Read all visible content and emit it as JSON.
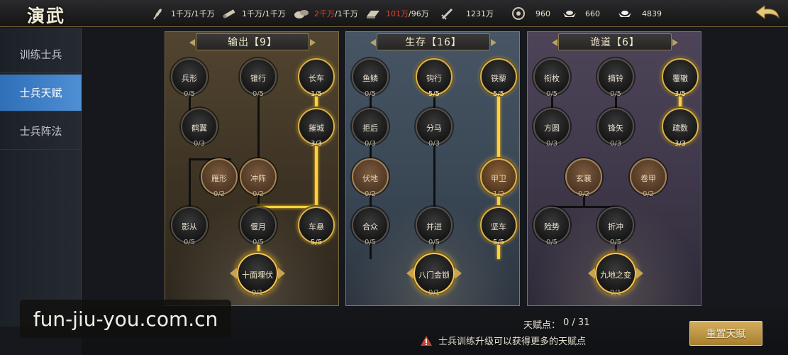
{
  "header": {
    "title": "演武",
    "resources": [
      {
        "icon": "wheat-icon",
        "value": "1千万",
        "cap": "/1千万",
        "over": false
      },
      {
        "icon": "wood-icon",
        "value": "1千万",
        "cap": "/1千万",
        "over": false
      },
      {
        "icon": "stone-icon",
        "value": "2千万",
        "cap": "/1千万",
        "over": true
      },
      {
        "icon": "iron-icon",
        "value": "101万",
        "cap": "/96万",
        "over": true
      },
      {
        "icon": "sword-icon",
        "value": "1231万",
        "cap": "",
        "over": false
      },
      {
        "icon": "coin-icon",
        "value": "960",
        "cap": "",
        "over": false
      },
      {
        "icon": "gold-ingot-icon",
        "value": "660",
        "cap": "",
        "over": false
      },
      {
        "icon": "silver-ingot-icon",
        "value": "4839",
        "cap": "",
        "over": false
      }
    ]
  },
  "sidebar": {
    "items": [
      {
        "label": "训练士兵",
        "active": false
      },
      {
        "label": "士兵天赋",
        "active": true
      },
      {
        "label": "士兵阵法",
        "active": false
      }
    ]
  },
  "panels": [
    {
      "title": "输出【9】",
      "nodes": {
        "bingxing": {
          "name": "兵形",
          "level": "0/5"
        },
        "zhuixing": {
          "name": "锥行",
          "level": "0/5"
        },
        "changche": {
          "name": "长车",
          "level": "1/5"
        },
        "heyi": {
          "name": "鹤翼",
          "level": "0/3"
        },
        "cuicheng": {
          "name": "摧城",
          "level": "3/3"
        },
        "yanxing": {
          "name": "雁形",
          "level": "0/2"
        },
        "chongzhen": {
          "name": "冲阵",
          "level": "0/2"
        },
        "yingcong": {
          "name": "影从",
          "level": "0/5"
        },
        "yanyue": {
          "name": "偃月",
          "level": "0/5"
        },
        "chexuan": {
          "name": "车悬",
          "level": "5/5"
        },
        "ultimate": {
          "name": "十面埋伏",
          "level": "0/1"
        }
      }
    },
    {
      "title": "生存【16】",
      "nodes": {
        "yulin": {
          "name": "鱼鳞",
          "level": "0/5"
        },
        "gouxing": {
          "name": "钩行",
          "level": "5/5"
        },
        "tieli": {
          "name": "铁藜",
          "level": "5/5"
        },
        "juhou": {
          "name": "拒后",
          "level": "0/3"
        },
        "fenma": {
          "name": "分马",
          "level": "0/3"
        },
        "fudi": {
          "name": "伏地",
          "level": "0/2"
        },
        "jiawei": {
          "name": "甲卫",
          "level": "1/2"
        },
        "hezhong": {
          "name": "合众",
          "level": "0/5"
        },
        "bingjin": {
          "name": "并进",
          "level": "0/5"
        },
        "jianche": {
          "name": "坚车",
          "level": "5/5"
        },
        "ultimate": {
          "name": "八门金锁",
          "level": "0/1"
        }
      }
    },
    {
      "title": "诡道【6】",
      "nodes": {
        "xianmei": {
          "name": "衔枚",
          "level": "0/5"
        },
        "zhailing": {
          "name": "摘铃",
          "level": "0/5"
        },
        "fuche": {
          "name": "覆辙",
          "level": "3/5"
        },
        "fangyuan": {
          "name": "方圆",
          "level": "0/3"
        },
        "fengshi": {
          "name": "锋矢",
          "level": "0/3"
        },
        "shushu": {
          "name": "疏数",
          "level": "3/3"
        },
        "xuanxiang": {
          "name": "玄襄",
          "level": "0/2"
        },
        "juanjia": {
          "name": "卷甲",
          "level": "0/2"
        },
        "xianshi": {
          "name": "险势",
          "level": "0/5"
        },
        "zhechong": {
          "name": "折冲",
          "level": "0/5"
        },
        "ultimate": {
          "name": "九地之变",
          "level": "0/1"
        }
      }
    }
  ],
  "footer": {
    "points_label": "天赋点：",
    "points_value": "0 / 31",
    "hint": "士兵训练升级可以获得更多的天赋点",
    "reset_label": "重置天赋",
    "watermark": "fun-jiu-you.com.cn"
  },
  "colors": {
    "gold": "#ffd23c",
    "active_tab": "#3c7fc6",
    "over_cap": "#e0402e"
  }
}
